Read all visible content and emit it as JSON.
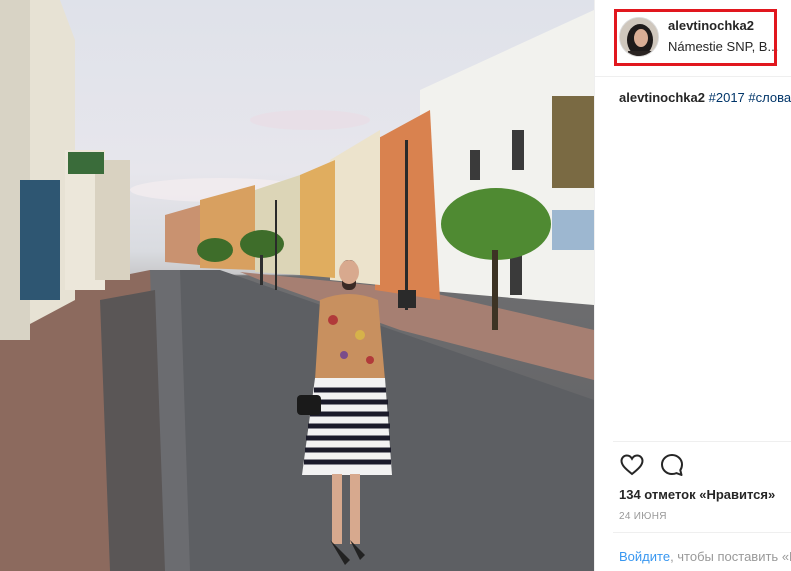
{
  "post": {
    "photo_alt": "",
    "header": {
      "username": "alevtinochka2",
      "location": "Námestie SNP, B..."
    },
    "caption": {
      "username": "alevtinochka2",
      "text": "#2017 #слова"
    },
    "actions": {
      "like_icon": "heart-icon",
      "comment_icon": "comment-icon"
    },
    "likes": "134 отметок «Нравится»",
    "date": "24 ИЮНЯ",
    "login_prompt": {
      "link_text": "Войдите",
      "rest_text": ", чтобы поставить «Нравится»"
    }
  },
  "colors": {
    "link": "#3897f0",
    "hashtag": "#003569",
    "highlight": "#e1171e",
    "muted": "#999999"
  }
}
